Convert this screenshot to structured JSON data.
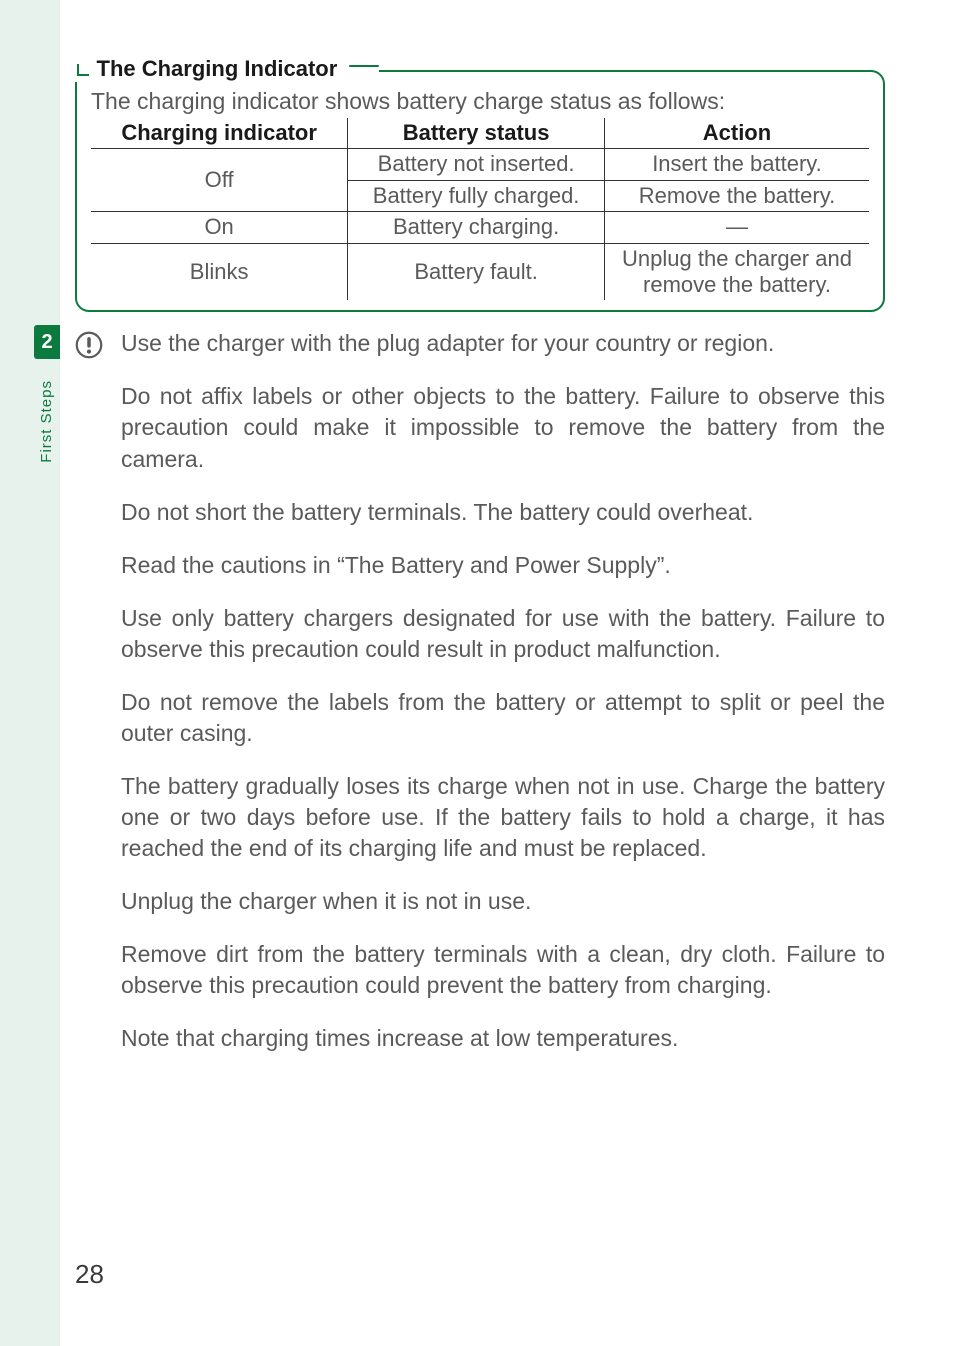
{
  "chapter_number": "2",
  "side_label": "First Steps",
  "callout": {
    "title": "The Charging Indicator",
    "intro": "The charging indicator shows battery charge status as follows:"
  },
  "table": {
    "headers": [
      "Charging indicator",
      "Battery status",
      "Action"
    ],
    "rows": [
      {
        "indicator": "Off",
        "status": "Battery not inserted.",
        "action": "Insert the battery."
      },
      {
        "indicator": "",
        "status": "Battery fully charged.",
        "action": "Remove the battery."
      },
      {
        "indicator": "On",
        "status": "Battery charging.",
        "action": "—"
      },
      {
        "indicator": "Blinks",
        "status": "Battery fault.",
        "action": "Unplug the charger and remove the battery."
      }
    ]
  },
  "cautions": [
    "Use the charger with the plug adapter for your country or region.",
    "Do not affix labels or other objects to the battery.  Failure to observe this precaution could make it impossible to remove the battery from the camera.",
    "Do not short the battery terminals.  The battery could overheat.",
    "Read the cautions in “The Battery and Power Supply”.",
    "Use only battery chargers designated for use with the battery.  Failure to observe this precaution could result in product malfunction.",
    "Do not remove the labels from the battery or attempt to split or peel the outer casing.",
    "The battery gradually loses its charge when not in use.  Charge the battery one or two days before use.  If the battery fails to hold a charge, it has reached the end of its charging life and must be replaced.",
    "Unplug the charger when it is not in use.",
    "Remove dirt from the battery terminals with a clean, dry cloth.  Failure to observe this precaution could prevent the battery from charging.",
    "Note that charging times increase at low temperatures."
  ],
  "page_number": "28"
}
